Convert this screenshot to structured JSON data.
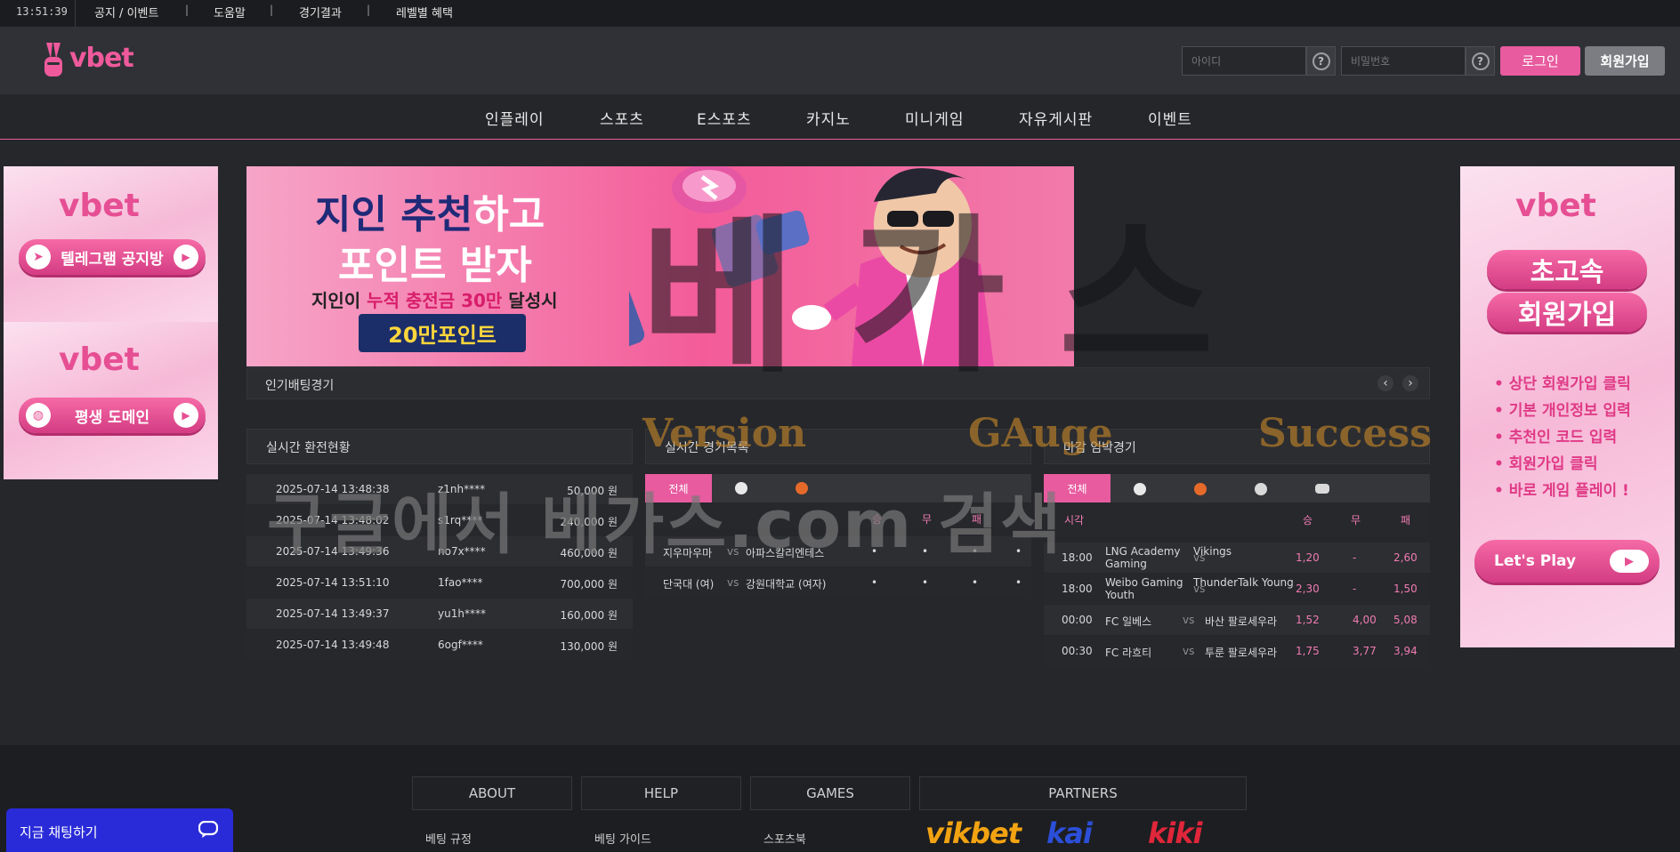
{
  "topbar": {
    "time": "13:51:39",
    "links": [
      "공지 / 이벤트",
      "도움말",
      "경기결과",
      "레벨별 혜택"
    ],
    "separator": "|"
  },
  "header": {
    "logo_text": "vbet",
    "id_placeholder": "아이디",
    "pw_placeholder": "비밀번호",
    "help_glyph": "?",
    "login_label": "로그인",
    "join_label": "회원가입"
  },
  "nav": {
    "items": [
      "인플레이",
      "스포츠",
      "E스포츠",
      "카지노",
      "미니게임",
      "자유게시판",
      "이벤트"
    ]
  },
  "left_banners": [
    {
      "logo": "vbet",
      "button": "텔레그램 공지방"
    },
    {
      "logo": "vbet",
      "button": "평생 도메인"
    }
  ],
  "right_banner": {
    "logo": "vbet",
    "title1": "초고속",
    "title2": "회원가입",
    "steps": [
      "• 상단 회원가입 클릭",
      "• 기본 개인정보 입력",
      "• 추천인 코드 입력",
      "• 회원가입 클릭",
      "• 바로 게임 플레이 !"
    ],
    "cta": "Let's Play"
  },
  "main_banner": {
    "line1_a": "지인 추천",
    "line1_b": "하고",
    "line2": "포인트 받자",
    "line3_a": "지인이 ",
    "line3_b": "누적 충전금 30만",
    "line3_c": " 달성시",
    "points": "20만포인트"
  },
  "popular": {
    "title": "인기배팅경기",
    "prev": "‹",
    "next": "›"
  },
  "exchange": {
    "title": "실시간 환전현황",
    "rows": [
      {
        "time": "2025-07-14 13:48:38",
        "user": "z1nh****",
        "amount": "50,000 원"
      },
      {
        "time": "2025-07-14 13:48:02",
        "user": "s1rq****",
        "amount": "240,000 원"
      },
      {
        "time": "2025-07-14 13:49:36",
        "user": "no7x****",
        "amount": "460,000 원"
      },
      {
        "time": "2025-07-14 13:51:10",
        "user": "1fao****",
        "amount": "700,000 원"
      },
      {
        "time": "2025-07-14 13:49:37",
        "user": "yu1h****",
        "amount": "160,000 원"
      },
      {
        "time": "2025-07-14 13:49:48",
        "user": "6ogf****",
        "amount": "130,000 원"
      }
    ]
  },
  "live": {
    "title": "실시간 경기목록",
    "all_label": "전체",
    "col_headers": [
      "승",
      "무",
      "패"
    ],
    "vs": "vs",
    "dot": "•",
    "rows": [
      {
        "home": "지우마우마",
        "away": "아파스칼리엔테스"
      },
      {
        "home": "단국대 (여)",
        "away": "강원대학교 (여자)"
      }
    ]
  },
  "deadline": {
    "title": "마감 임박경기",
    "all_label": "전체",
    "time_header": "시각",
    "col_headers": [
      "승",
      "무",
      "패"
    ],
    "vs": "vs",
    "rows": [
      {
        "time": "18:00",
        "home": "LNG Academy Gaming",
        "away": "Vikings",
        "w": "1,20",
        "d": "-",
        "l": "2,60"
      },
      {
        "time": "18:00",
        "home": "Weibo Gaming Youth",
        "away": "ThunderTalk Young",
        "w": "2,30",
        "d": "-",
        "l": "1,50"
      },
      {
        "time": "00:00",
        "home": "FC 일베스",
        "away": "바산 팔로세우라",
        "w": "1,52",
        "d": "4,00",
        "l": "5,08"
      },
      {
        "time": "00:30",
        "home": "FC 라흐티",
        "away": "투룬 팔로세우라",
        "w": "1,75",
        "d": "3,77",
        "l": "3,94"
      }
    ]
  },
  "watermark": {
    "big": "베가스",
    "words": [
      "Version",
      "GAuge",
      "Success"
    ],
    "bottom": "구글에서 베가스.com 검색"
  },
  "footer": {
    "tabs": [
      "ABOUT",
      "HELP",
      "GAMES",
      "PARTNERS"
    ],
    "links": [
      "베팅 규정",
      "베팅 가이드",
      "스포츠북"
    ],
    "partners": [
      "vikbet",
      "kai",
      "kiki"
    ]
  },
  "chat": {
    "label": "지금 채팅하기"
  },
  "colors": {
    "accent": "#e85b9f",
    "bg": "#25272b",
    "chat": "#2a2bd8"
  }
}
